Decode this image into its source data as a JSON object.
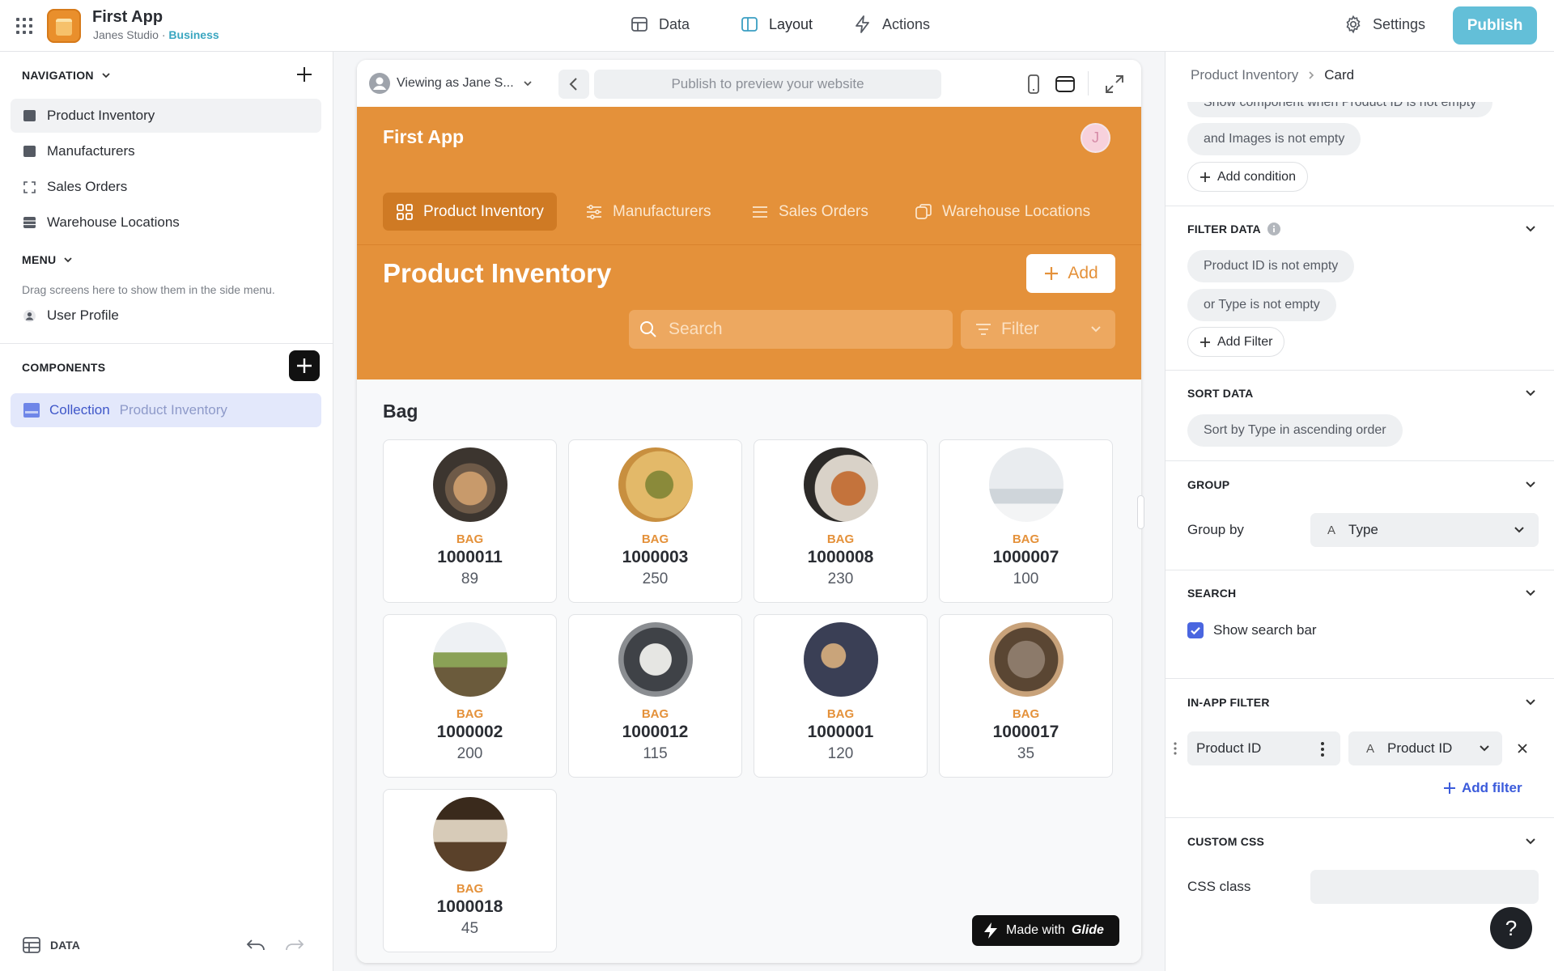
{
  "topbar": {
    "app_title": "First App",
    "studio": "Janes Studio",
    "separator": "·",
    "plan": "Business",
    "nav": [
      {
        "label": "Data",
        "icon": "table-icon"
      },
      {
        "label": "Layout",
        "icon": "layout-icon"
      },
      {
        "label": "Actions",
        "icon": "bolt-icon"
      }
    ],
    "settings_label": "Settings",
    "publish_label": "Publish"
  },
  "sidebar": {
    "navigation_heading": "NAVIGATION",
    "nav_items": [
      "Product Inventory",
      "Manufacturers",
      "Sales Orders",
      "Warehouse Locations"
    ],
    "menu_heading": "MENU",
    "menu_hint": "Drag screens here to show them in the side menu.",
    "menu_items": [
      "User Profile"
    ],
    "components_heading": "COMPONENTS",
    "component": {
      "type": "Collection",
      "source": "Product Inventory"
    },
    "footer_data": "DATA"
  },
  "preview": {
    "viewing_as": "Viewing as Jane S...",
    "url_placeholder": "Publish to preview your website",
    "app_name": "First App",
    "avatar_initial": "J",
    "tabs": [
      "Product Inventory",
      "Manufacturers",
      "Sales Orders",
      "Warehouse Locations"
    ],
    "page_title": "Product Inventory",
    "add_label": "Add",
    "search_placeholder": "Search",
    "filter_label": "Filter",
    "group_title": "Bag",
    "made_with": "Made with",
    "made_with_brand": "Glide",
    "cards": [
      {
        "type": "BAG",
        "id": "1000011",
        "value": "89"
      },
      {
        "type": "BAG",
        "id": "1000003",
        "value": "250"
      },
      {
        "type": "BAG",
        "id": "1000008",
        "value": "230"
      },
      {
        "type": "BAG",
        "id": "1000007",
        "value": "100"
      },
      {
        "type": "BAG",
        "id": "1000002",
        "value": "200"
      },
      {
        "type": "BAG",
        "id": "1000012",
        "value": "115"
      },
      {
        "type": "BAG",
        "id": "1000001",
        "value": "120"
      },
      {
        "type": "BAG",
        "id": "1000017",
        "value": "35"
      },
      {
        "type": "BAG",
        "id": "1000018",
        "value": "45"
      }
    ]
  },
  "panel": {
    "breadcrumb_parent": "Product Inventory",
    "breadcrumb_current": "Card",
    "visibility_conditions": [
      "Show component when Product ID is not empty",
      "and Images is not empty"
    ],
    "add_condition": "Add condition",
    "filter_heading": "FILTER DATA",
    "filters": [
      "Product ID is not empty",
      "or Type is not empty"
    ],
    "add_filter": "Add Filter",
    "sort_heading": "SORT DATA",
    "sort": "Sort by Type in ascending order",
    "group_heading": "GROUP",
    "group_by_label": "Group by",
    "group_by_value": "Type",
    "search_heading": "SEARCH",
    "show_search_bar": "Show search bar",
    "inapp_heading": "IN-APP FILTER",
    "inapp_field": "Product ID",
    "inapp_column": "Product ID",
    "add_filter_link": "Add filter",
    "css_heading": "CUSTOM CSS",
    "css_class_label": "CSS class",
    "css_class_value": ""
  },
  "colors": {
    "accent": "#E4913A",
    "publish": "#63BFD8",
    "selection": "#4A66E0"
  }
}
